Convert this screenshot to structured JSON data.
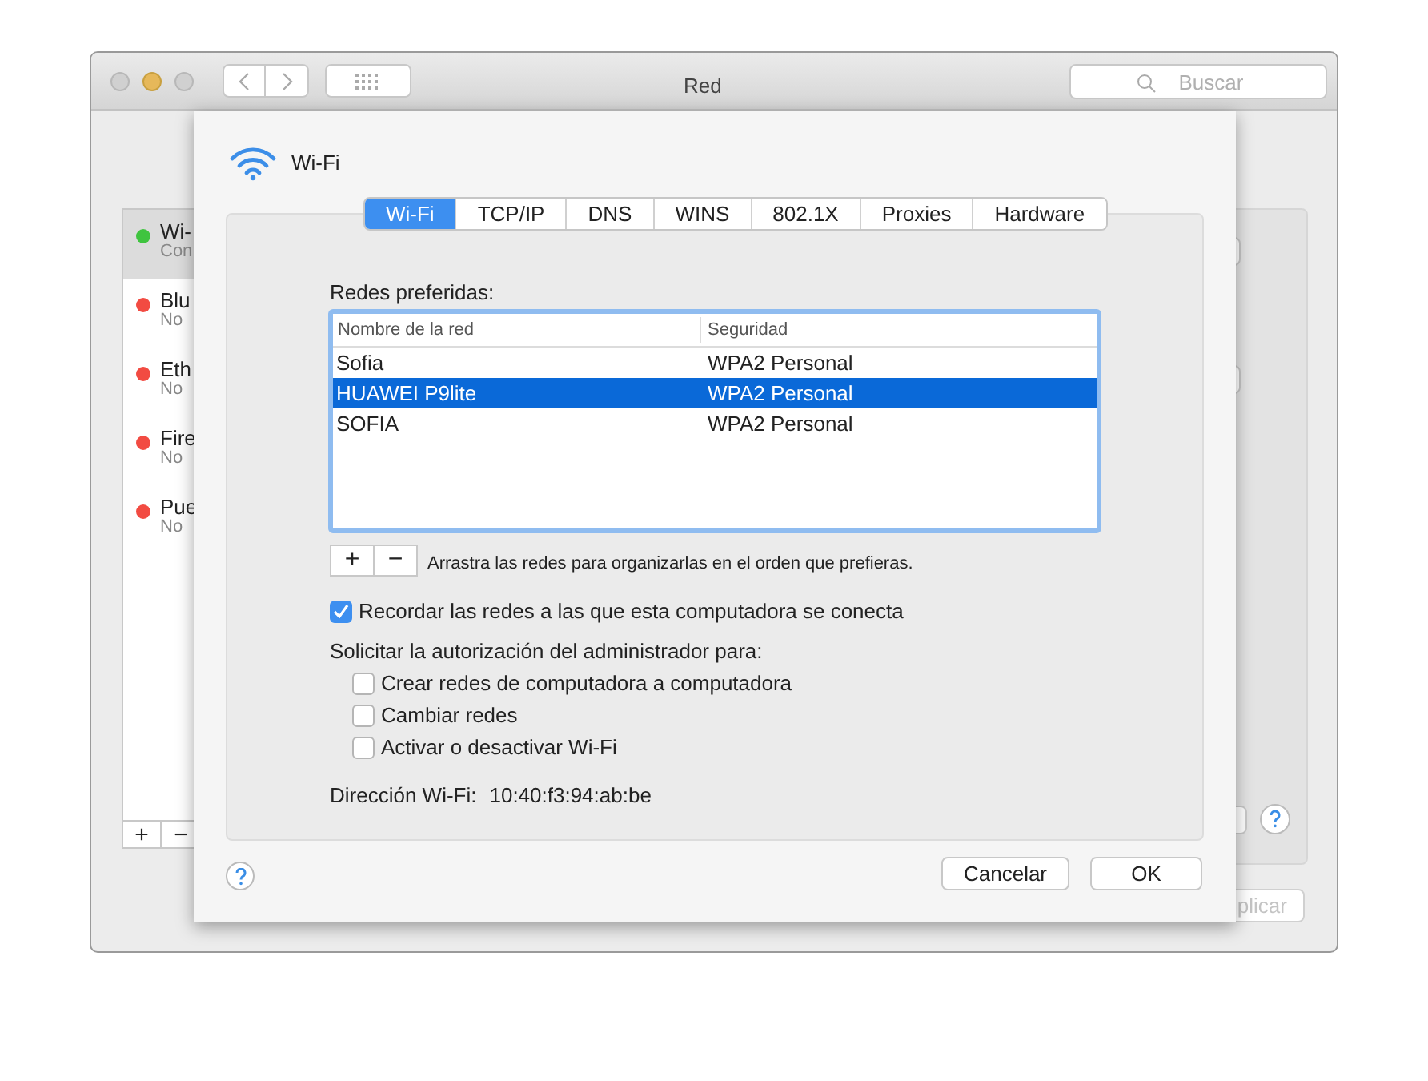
{
  "window": {
    "title": "Red",
    "search_placeholder": "Buscar"
  },
  "sidebar": {
    "items": [
      {
        "name": "Wi-",
        "status": "Con",
        "color": "#3fc43f",
        "selected": true
      },
      {
        "name": "Blu",
        "status": "No",
        "color": "#f24b42",
        "selected": false
      },
      {
        "name": "Eth",
        "status": "No",
        "color": "#f24b42",
        "selected": false
      },
      {
        "name": "Fire",
        "status": "No",
        "color": "#f24b42",
        "selected": false
      },
      {
        "name": "Pue",
        "status": "No",
        "color": "#f24b42",
        "selected": false
      }
    ],
    "buttons": [
      "+",
      "−"
    ]
  },
  "apply_button": {
    "label": "plicar",
    "disabled": true
  },
  "sheet": {
    "title": "Wi-Fi",
    "tabs": [
      {
        "label": "Wi-Fi",
        "selected": true
      },
      {
        "label": "TCP/IP",
        "selected": false
      },
      {
        "label": "DNS",
        "selected": false
      },
      {
        "label": "WINS",
        "selected": false
      },
      {
        "label": "802.1X",
        "selected": false
      },
      {
        "label": "Proxies",
        "selected": false
      },
      {
        "label": "Hardware",
        "selected": false
      }
    ],
    "preferred_label": "Redes preferidas:",
    "table": {
      "columns": [
        "Nombre de la red",
        "Seguridad"
      ],
      "rows": [
        {
          "network": "Sofia",
          "security": "WPA2 Personal",
          "selected": false
        },
        {
          "network": "HUAWEI P9lite",
          "security": "WPA2 Personal",
          "selected": true
        },
        {
          "network": "SOFIA",
          "security": "WPA2 Personal",
          "selected": false
        }
      ]
    },
    "list_buttons": [
      "+",
      "−"
    ],
    "hint": "Arrastra las redes para organizarlas en el orden que prefieras.",
    "remember": {
      "label": "Recordar las redes a las que esta computadora se conecta",
      "checked": true
    },
    "admin_label": "Solicitar la autorización del administrador para:",
    "admin_options": [
      {
        "label": "Crear redes de computadora a computadora",
        "checked": false
      },
      {
        "label": "Cambiar redes",
        "checked": false
      },
      {
        "label": "Activar o desactivar Wi-Fi",
        "checked": false
      }
    ],
    "address_label": "Dirección Wi-Fi:",
    "address": "10:40:f3:94:ab:be",
    "buttons": [
      {
        "label": "Cancelar",
        "kind": "cancel"
      },
      {
        "label": "OK",
        "kind": "confirm"
      }
    ]
  }
}
